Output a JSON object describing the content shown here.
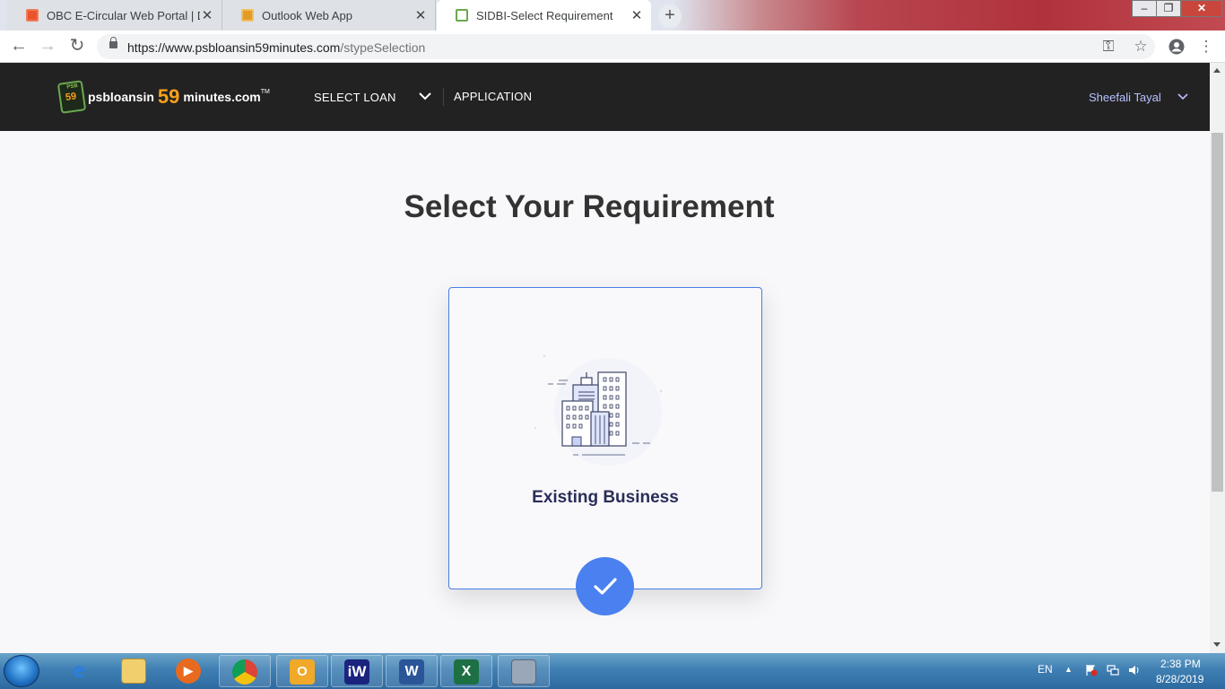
{
  "browser": {
    "tabs": [
      {
        "title": "OBC E-Circular Web Portal | Dash",
        "active": false
      },
      {
        "title": "Outlook Web App",
        "active": false
      },
      {
        "title": "SIDBI-Select Requirement",
        "active": true
      }
    ],
    "new_tab_label": "+",
    "url_host": "https://www.psbloansin59minutes.com",
    "url_path": "/stypeSelection"
  },
  "site": {
    "logo": {
      "badge_top": "PSB",
      "badge_num": "59",
      "text_left": "psbloansin",
      "number": "59",
      "text_right": "minutes.com",
      "tm": "TM"
    },
    "nav": {
      "select_loan": "SELECT LOAN",
      "application": "APPLICATION"
    },
    "user_name": "Sheefali Tayal"
  },
  "main": {
    "heading": "Select Your Requirement",
    "option_label": "Existing Business",
    "option_selected": true
  },
  "taskbar": {
    "language": "EN",
    "time": "2:38 PM",
    "date": "8/28/2019"
  },
  "colors": {
    "accent": "#4a80f0",
    "header_bg": "#222222",
    "logo_orange": "#f7a01c"
  }
}
